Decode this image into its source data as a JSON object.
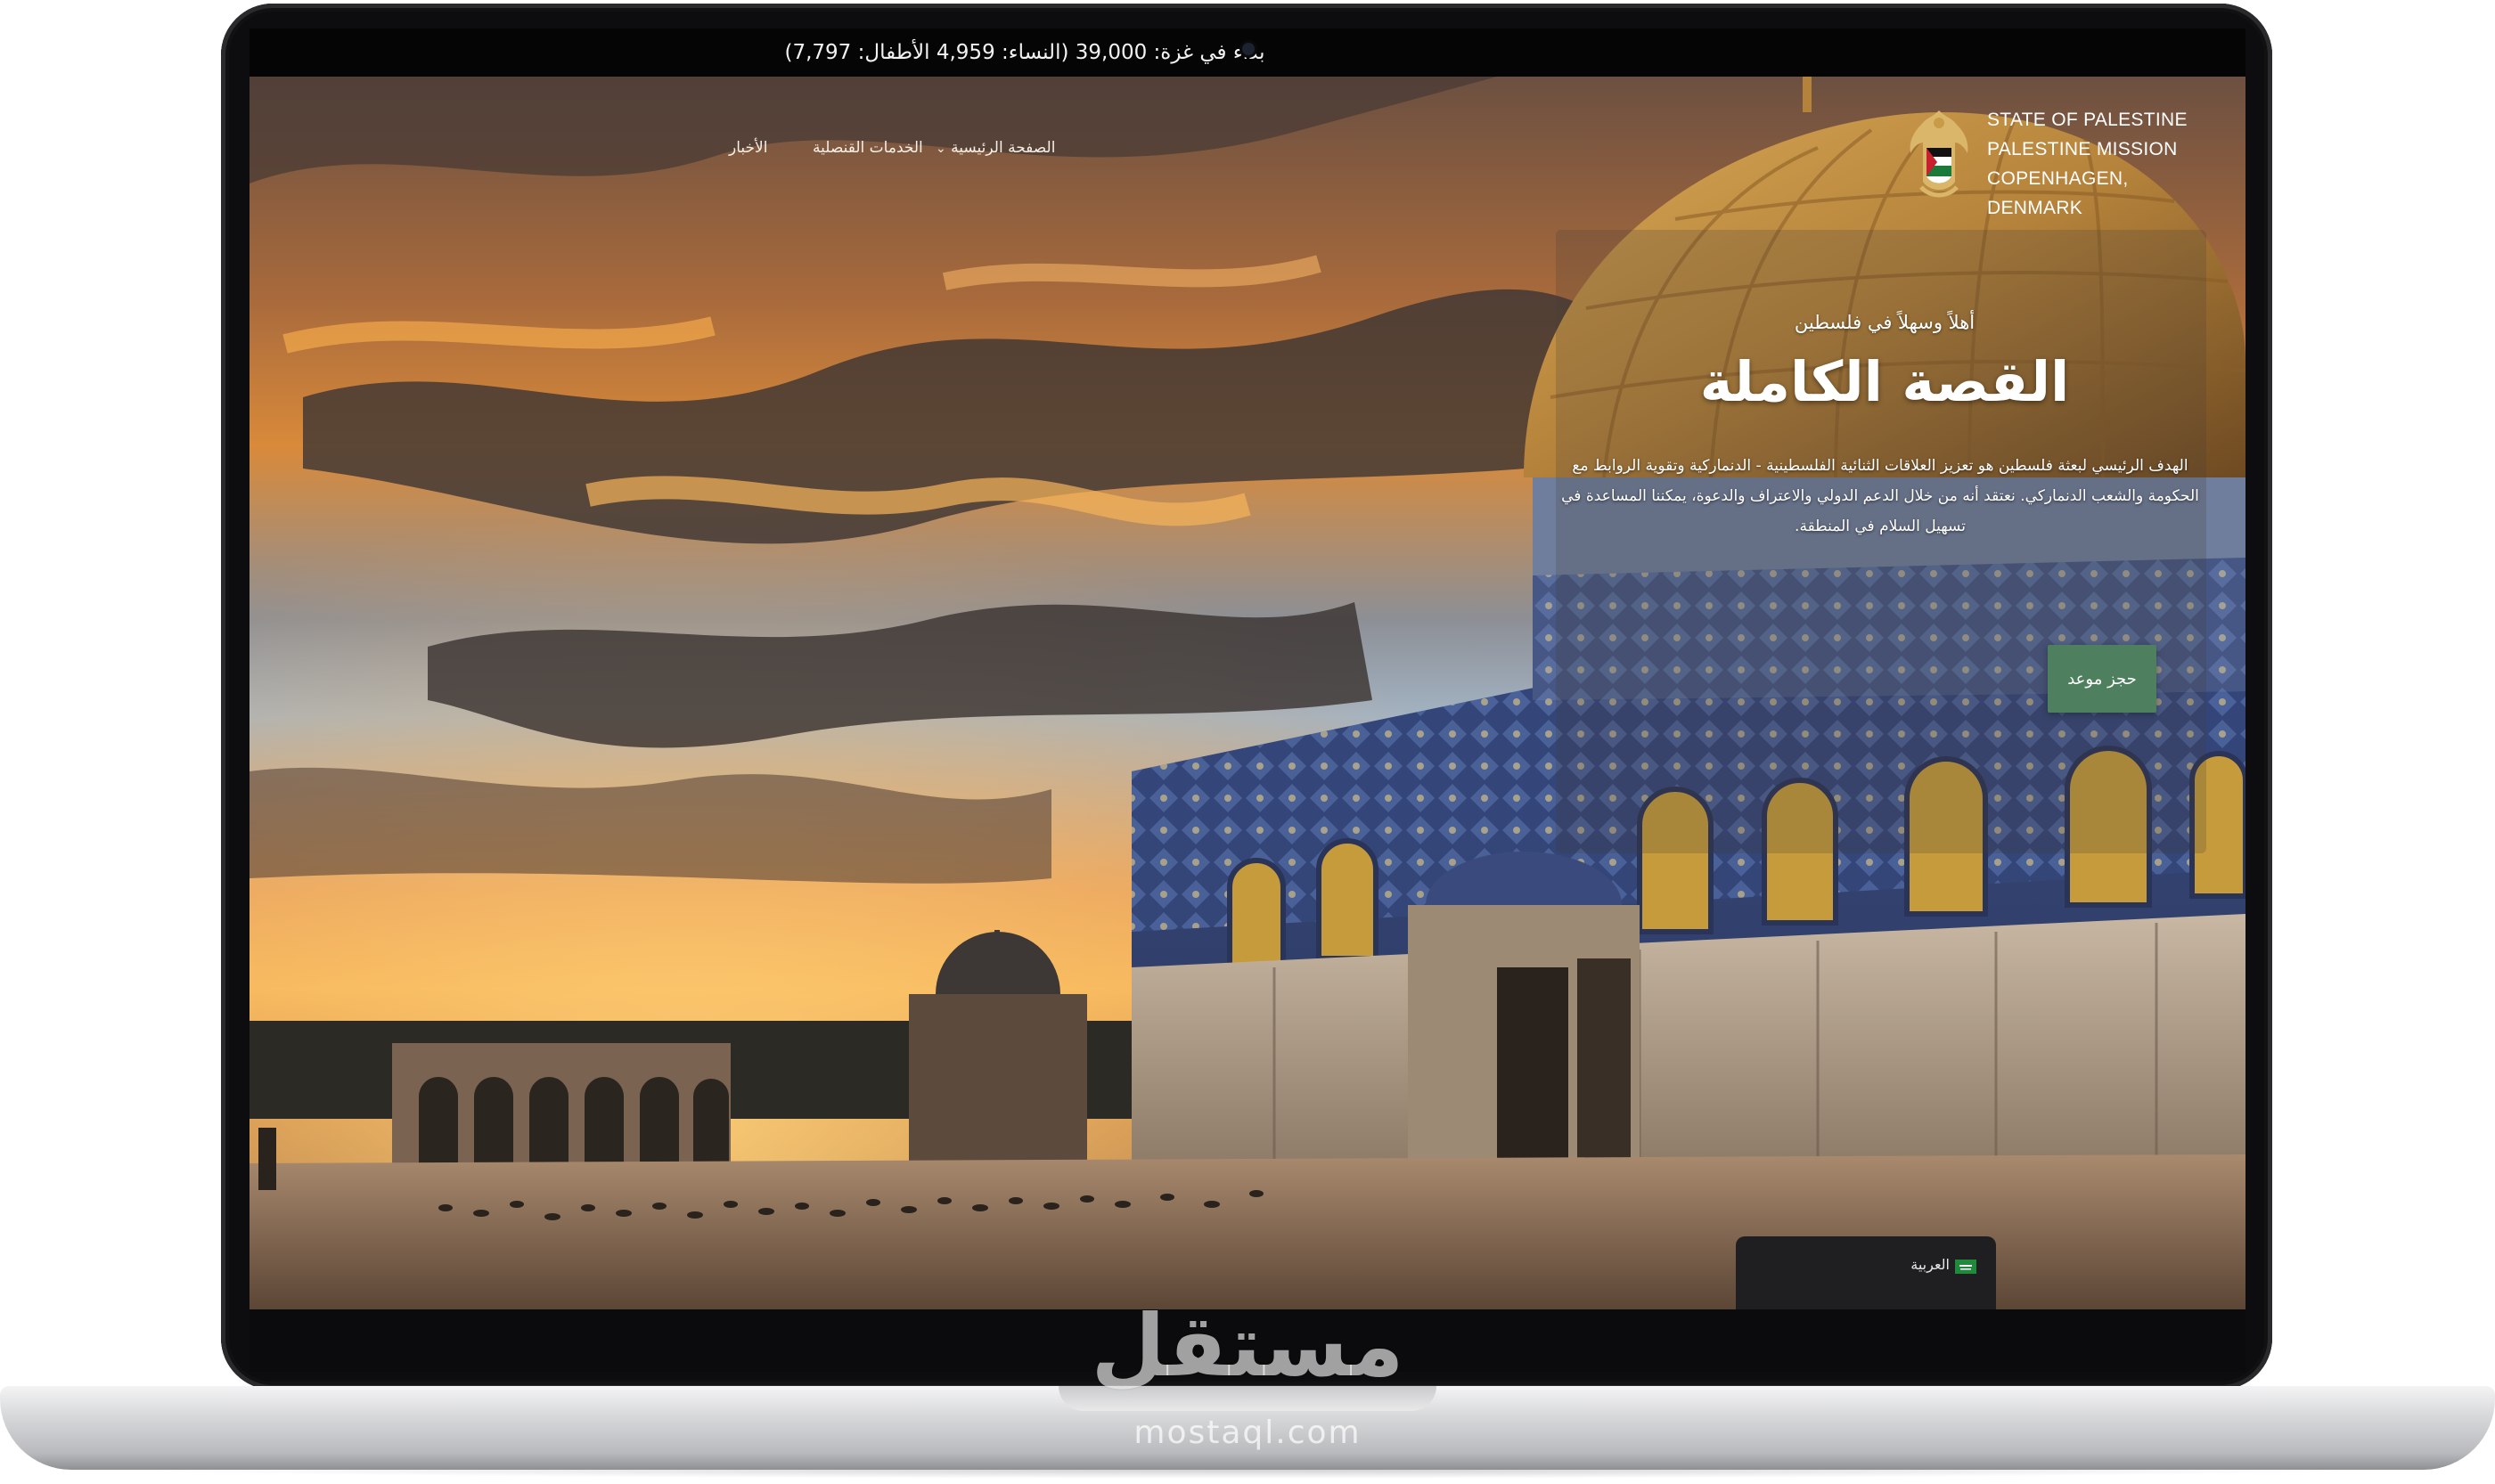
{
  "top_bar": {
    "banner": "بداء في غزة: 39,000 (النساء: 4,959 الأطفال: 7,797)"
  },
  "header": {
    "brand": {
      "line1": "STATE OF PALESTINE",
      "line2": "PALESTINE MISSION",
      "line3": "COPENHAGEN, DENMARK",
      "emblem_icon": "palestine-eagle-emblem-icon"
    },
    "nav": [
      {
        "label": "الصفحة الرئيسية",
        "icon": "chevron-down-icon"
      },
      {
        "label": "الخدمات القنصلية"
      },
      {
        "label": "الأخبار"
      }
    ]
  },
  "hero": {
    "eyebrow": "أهلاً وسهلاً في فلسطين",
    "title": "القصة الكاملة",
    "description": "الهدف الرئيسي لبعثة فلسطين هو تعزيز العلاقات الثنائية الفلسطينية - الدنماركية وتقوية الروابط مع الحكومة والشعب الدنماركي. نعتقد أنه من خلال الدعم الدولي والاعتراف والدعوة، يمكننا المساعدة في تسهيل السلام في المنطقة.",
    "cta_label": "حجز موعد"
  },
  "language_switcher": {
    "label": "العربية",
    "flag_icon": "saudi-flag-icon"
  },
  "watermark": {
    "text": "مستقل",
    "sub": "mostaql.com"
  },
  "colors": {
    "cta_background": "#4e7f5e",
    "laptop_body": "#0d0d0f",
    "laptop_base": "#c4c5c8"
  }
}
